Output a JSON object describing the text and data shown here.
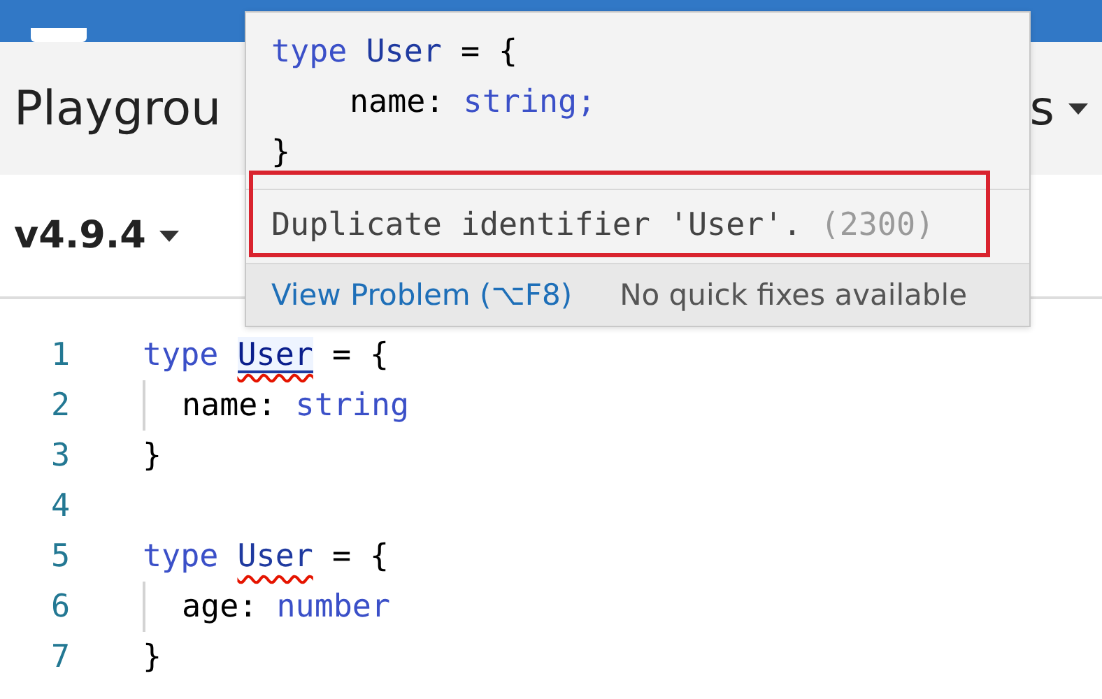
{
  "header": {
    "title": "Playgrou",
    "menu_label": "s"
  },
  "version": {
    "label": "v4.9.4"
  },
  "editor": {
    "lines": [
      {
        "number": "1",
        "indented": false,
        "tokens": [
          {
            "kind": "keyword",
            "text": "type"
          },
          {
            "kind": "ident",
            "text": "User",
            "error": true,
            "hovered": true
          },
          {
            "kind": "punct",
            "text": "= {"
          }
        ]
      },
      {
        "number": "2",
        "indented": true,
        "tokens": [
          {
            "kind": "plain",
            "text": "name:"
          },
          {
            "kind": "type",
            "text": "string"
          }
        ]
      },
      {
        "number": "3",
        "indented": false,
        "tokens": [
          {
            "kind": "punct",
            "text": "}"
          }
        ]
      },
      {
        "number": "4",
        "indented": false
      },
      {
        "number": "5",
        "indented": false,
        "tokens": [
          {
            "kind": "keyword",
            "text": "type"
          },
          {
            "kind": "ident",
            "text": "User",
            "error": true,
            "hovered": false
          },
          {
            "kind": "punct",
            "text": "= {"
          }
        ]
      },
      {
        "number": "6",
        "indented": true,
        "tokens": [
          {
            "kind": "plain",
            "text": "age:"
          },
          {
            "kind": "type",
            "text": "number"
          }
        ]
      },
      {
        "number": "7",
        "indented": false,
        "tokens": [
          {
            "kind": "punct",
            "text": "}"
          }
        ]
      }
    ]
  },
  "hover": {
    "code": [
      {
        "indented": false,
        "tokens": [
          {
            "kind": "keyword",
            "text": "type"
          },
          {
            "kind": "ident",
            "text": "User"
          },
          {
            "kind": "punct",
            "text": "= {"
          }
        ]
      },
      {
        "indented": true,
        "tokens": [
          {
            "kind": "plain",
            "text": "name:"
          },
          {
            "kind": "type",
            "text": "string;"
          }
        ]
      },
      {
        "indented": false,
        "tokens": [
          {
            "kind": "punct",
            "text": "}"
          }
        ]
      }
    ],
    "message": "Duplicate identifier 'User'.",
    "error_code": "(2300)",
    "annotated": true,
    "link": "View Problem (⌥F8)",
    "status": "No quick fixes available"
  }
}
